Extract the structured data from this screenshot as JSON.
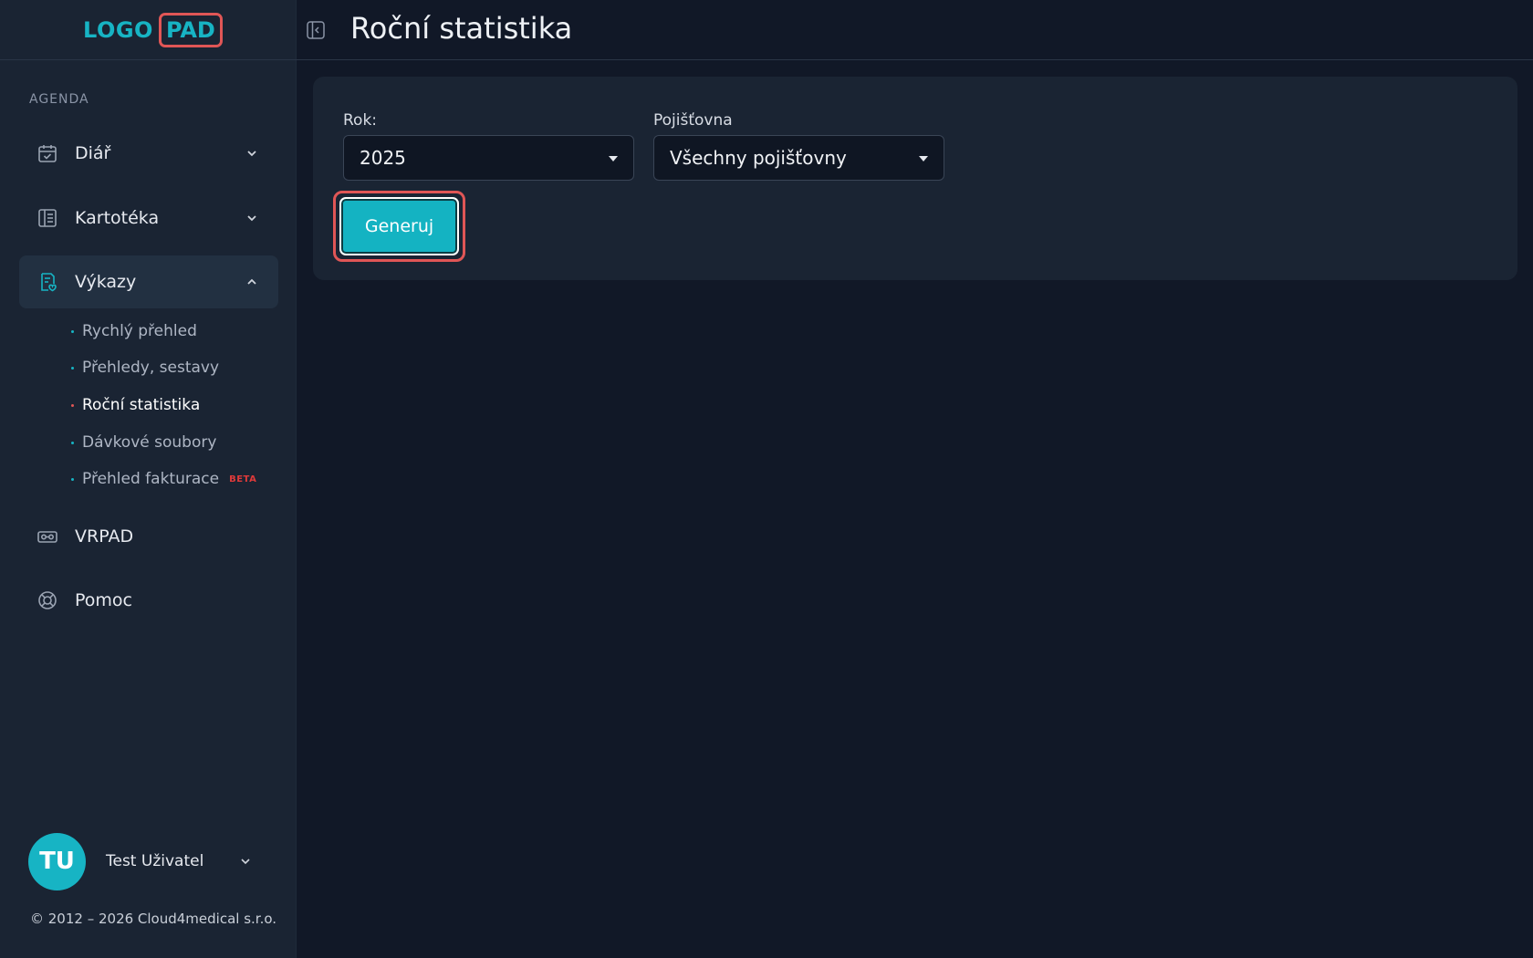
{
  "logo": {
    "part1": "LOGO",
    "part2": "PAD"
  },
  "sidebar": {
    "section_label": "AGENDA",
    "items": [
      {
        "label": "Diář",
        "icon": "calendar-check-icon"
      },
      {
        "label": "Kartotéka",
        "icon": "card-file-icon"
      },
      {
        "label": "Výkazy",
        "icon": "report-icon"
      },
      {
        "label": "VRPAD",
        "icon": "vr-headset-icon"
      },
      {
        "label": "Pomoc",
        "icon": "lifebuoy-icon"
      }
    ],
    "subitems": [
      {
        "label": "Rychlý přehled"
      },
      {
        "label": "Přehledy, sestavy"
      },
      {
        "label": "Roční statistika"
      },
      {
        "label": "Dávkové soubory"
      },
      {
        "label": "Přehled fakturace",
        "badge": "BETA"
      }
    ]
  },
  "user": {
    "initials": "TU",
    "name": "Test Uživatel"
  },
  "footer": {
    "copyright": "© 2012 – 2026 Cloud4medical s.r.o."
  },
  "header": {
    "title": "Roční statistika"
  },
  "form": {
    "year_label": "Rok:",
    "year_value": "2025",
    "insurer_label": "Pojišťovna",
    "insurer_value": "Všechny pojišťovny",
    "generate_label": "Generuj"
  },
  "colors": {
    "accent": "#17b4c4",
    "highlight": "#e05656",
    "background": "#111827",
    "sidebar": "#1a2433"
  }
}
